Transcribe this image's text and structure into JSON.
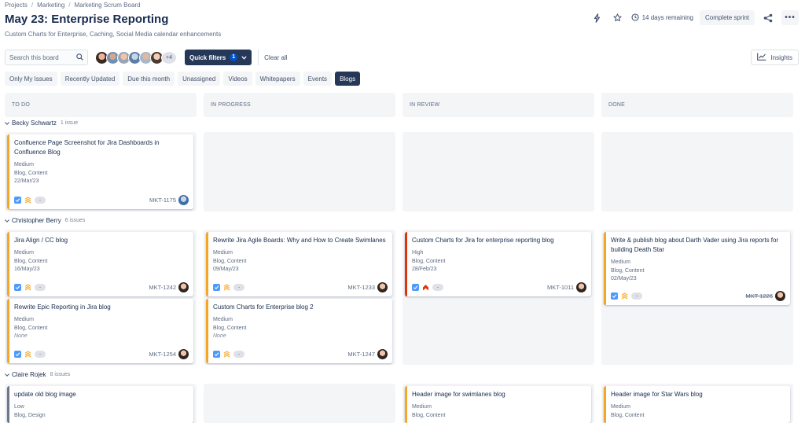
{
  "breadcrumb": [
    "Projects",
    "Marketing",
    "Marketing Scrum Board"
  ],
  "title": "May 23: Enterprise Reporting",
  "subtitle": "Custom Charts for Enterprise, Caching, Social Media calendar enhancements",
  "header": {
    "remaining": "14 days remaining",
    "complete_label": "Complete sprint",
    "more_label": "•••",
    "icons": [
      "lightning-icon",
      "star-icon",
      "clock-icon",
      "share-icon",
      "more-icon"
    ]
  },
  "filters": {
    "search_placeholder": "Search this board",
    "avatar_overflow": "+4",
    "quick_filters_label": "Quick filters",
    "quick_filters_count": "1",
    "clear_all": "Clear all",
    "insights": "Insights"
  },
  "chips": [
    {
      "label": "Only My Issues",
      "active": false
    },
    {
      "label": "Recently Updated",
      "active": false
    },
    {
      "label": "Due this month",
      "active": false
    },
    {
      "label": "Unassigned",
      "active": false
    },
    {
      "label": "Videos",
      "active": false
    },
    {
      "label": "Whitepapers",
      "active": false
    },
    {
      "label": "Events",
      "active": false
    },
    {
      "label": "Blogs",
      "active": true
    }
  ],
  "columns": [
    "TO DO",
    "IN PROGRESS",
    "IN REVIEW",
    "DONE"
  ],
  "swimlanes": [
    {
      "name": "Becky Schwartz",
      "count": "1 issue"
    },
    {
      "name": "Christopher Berry",
      "count": "6 issues"
    },
    {
      "name": "Claire Rojek",
      "count": "8 issues"
    }
  ],
  "pill_text": "-",
  "cards": [
    {
      "title": "Confluence Page Screenshot for Jira Dashboards in Confluence Blog",
      "priority": "Medium",
      "labels": "Blog, Content",
      "date": "22/Mar/23",
      "key": "MKT-1175"
    },
    {
      "title": "Jira Align / CC blog",
      "priority": "Medium",
      "labels": "Blog, Content",
      "date": "16/May/23",
      "key": "MKT-1242"
    },
    {
      "title": "Rewrite Jira Agile Boards: Why and How to Create Swimlanes",
      "priority": "Medium",
      "labels": "Blog, Content",
      "date": "09/May/23",
      "key": "MKT-1233"
    },
    {
      "title": "Custom Charts for Jira for enterprise reporting blog",
      "priority": "High",
      "labels": "Blog, Content",
      "date": "28/Feb/23",
      "key": "MKT-1011"
    },
    {
      "title": "Write & publish blog about Darth Vader using Jira reports for building Death Star",
      "priority": "Medium",
      "labels": "Blog, Content",
      "date": "02/May/23",
      "key": "MKT-1226"
    },
    {
      "title": "Rewrite Epic Reporting in Jira blog",
      "priority": "Medium",
      "labels": "Blog, Content",
      "date": "None",
      "key": "MKT-1254"
    },
    {
      "title": "Custom Charts for Enterprise blog 2",
      "priority": "Medium",
      "labels": "Blog, Content",
      "date": "None",
      "key": "MKT-1247"
    },
    {
      "title": "update old blog image",
      "priority": "Low",
      "labels": "Blog, Design",
      "date": "",
      "key": ""
    },
    {
      "title": "Header image for swimlanes blog",
      "priority": "Medium",
      "labels": "Blog, Content",
      "date": "",
      "key": ""
    },
    {
      "title": "Header image for Star Wars blog",
      "priority": "Medium",
      "labels": "Blog, Content",
      "date": "",
      "key": ""
    }
  ],
  "colors": {
    "dark_navy": "#253858",
    "medium_priority": "#f5a623",
    "high_priority": "#de350b",
    "low_priority": "#6b778c",
    "column_bg": "#f4f5f7"
  }
}
